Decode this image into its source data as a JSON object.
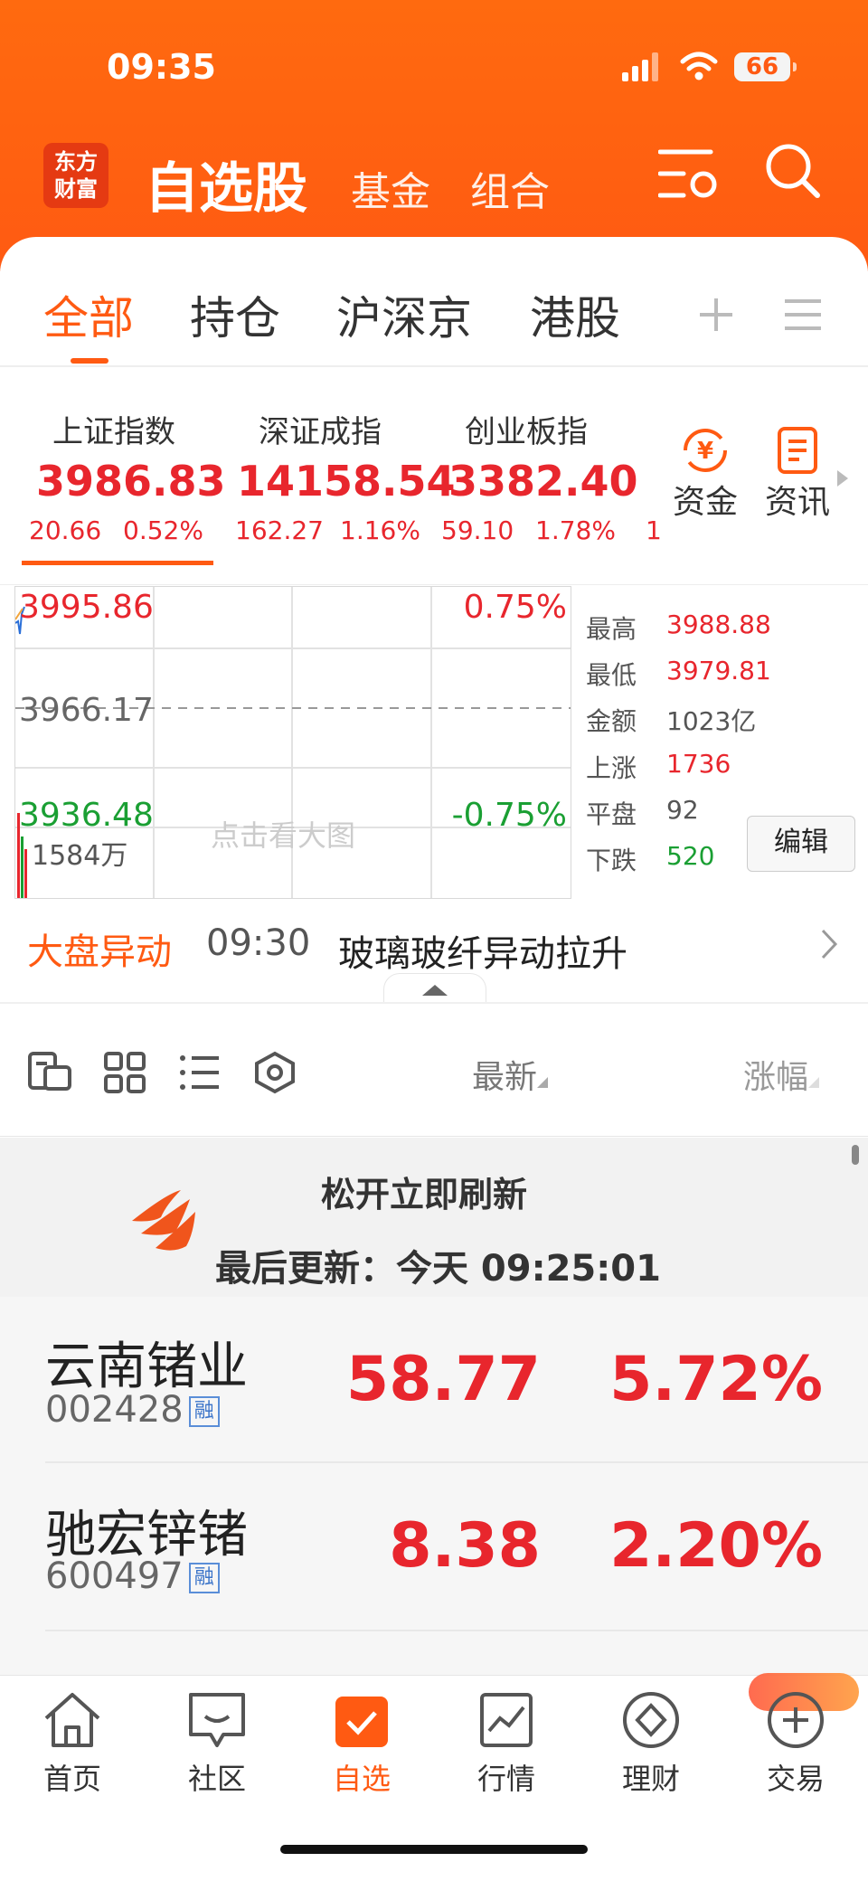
{
  "status_bar": {
    "time": "09:35",
    "battery": "66"
  },
  "app": {
    "logo_text_1": "东方",
    "logo_text_2": "财富"
  },
  "header": {
    "title": "自选股",
    "tab_fund": "基金",
    "tab_portfolio": "组合"
  },
  "tabs": [
    "全部",
    "持仓",
    "沪深京",
    "港股"
  ],
  "indices": [
    {
      "name": "上证指数",
      "value": "3986.83",
      "change": "20.66",
      "pct": "0.52%"
    },
    {
      "name": "深证成指",
      "value": "14158.54",
      "change": "162.27",
      "pct": "1.16%"
    },
    {
      "name": "创业板指",
      "value": "3382.40",
      "change": "59.10",
      "pct": "1.78%"
    }
  ],
  "index_more": "1",
  "shortcuts": {
    "funds": "资金",
    "news": "资讯"
  },
  "chart": {
    "high_label": "3995.86",
    "high_pct": "0.75%",
    "mid_label": "3966.17",
    "low_label": "3936.48",
    "low_pct": "-0.75%",
    "volume": "1584万",
    "hint": "点击看大图"
  },
  "stats": {
    "high": {
      "label": "最高",
      "value": "3988.88"
    },
    "low": {
      "label": "最低",
      "value": "3979.81"
    },
    "amount": {
      "label": "金额",
      "value": "1023亿"
    },
    "up": {
      "label": "上涨",
      "value": "1736"
    },
    "flat": {
      "label": "平盘",
      "value": "92"
    },
    "down": {
      "label": "下跌",
      "value": "520"
    },
    "edit": "编辑"
  },
  "alert": {
    "title": "大盘异动",
    "time": "09:30",
    "text": "玻璃玻纤异动拉升"
  },
  "sort": {
    "latest": "最新",
    "change": "涨幅"
  },
  "refresh": {
    "title": "松开立即刷新",
    "last_update": "最后更新：今天 09:25:01"
  },
  "stocks": [
    {
      "name": "云南锗业",
      "code": "002428",
      "tag": "融",
      "price": "58.77",
      "pct": "5.72%"
    },
    {
      "name": "驰宏锌锗",
      "code": "600497",
      "tag": "融",
      "price": "8.38",
      "pct": "2.20%"
    }
  ],
  "bottom_nav": [
    "首页",
    "社区",
    "自选",
    "行情",
    "理财",
    "交易"
  ],
  "colors": {
    "brand": "#ff5a12",
    "up": "#e8262d",
    "down": "#1a9f33"
  }
}
